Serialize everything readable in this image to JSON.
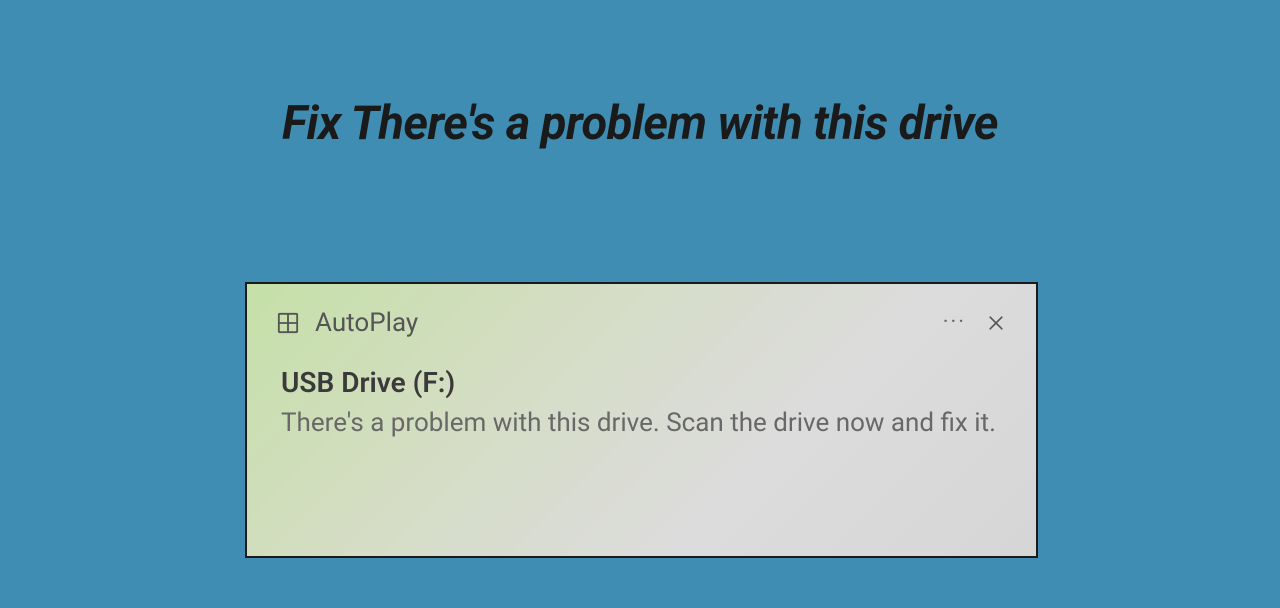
{
  "headline": "Fix There's a problem with this drive",
  "notification": {
    "app_name": "AutoPlay",
    "title": "USB Drive (F:)",
    "message": "There's a problem with this drive.  Scan the drive now and fix it."
  }
}
